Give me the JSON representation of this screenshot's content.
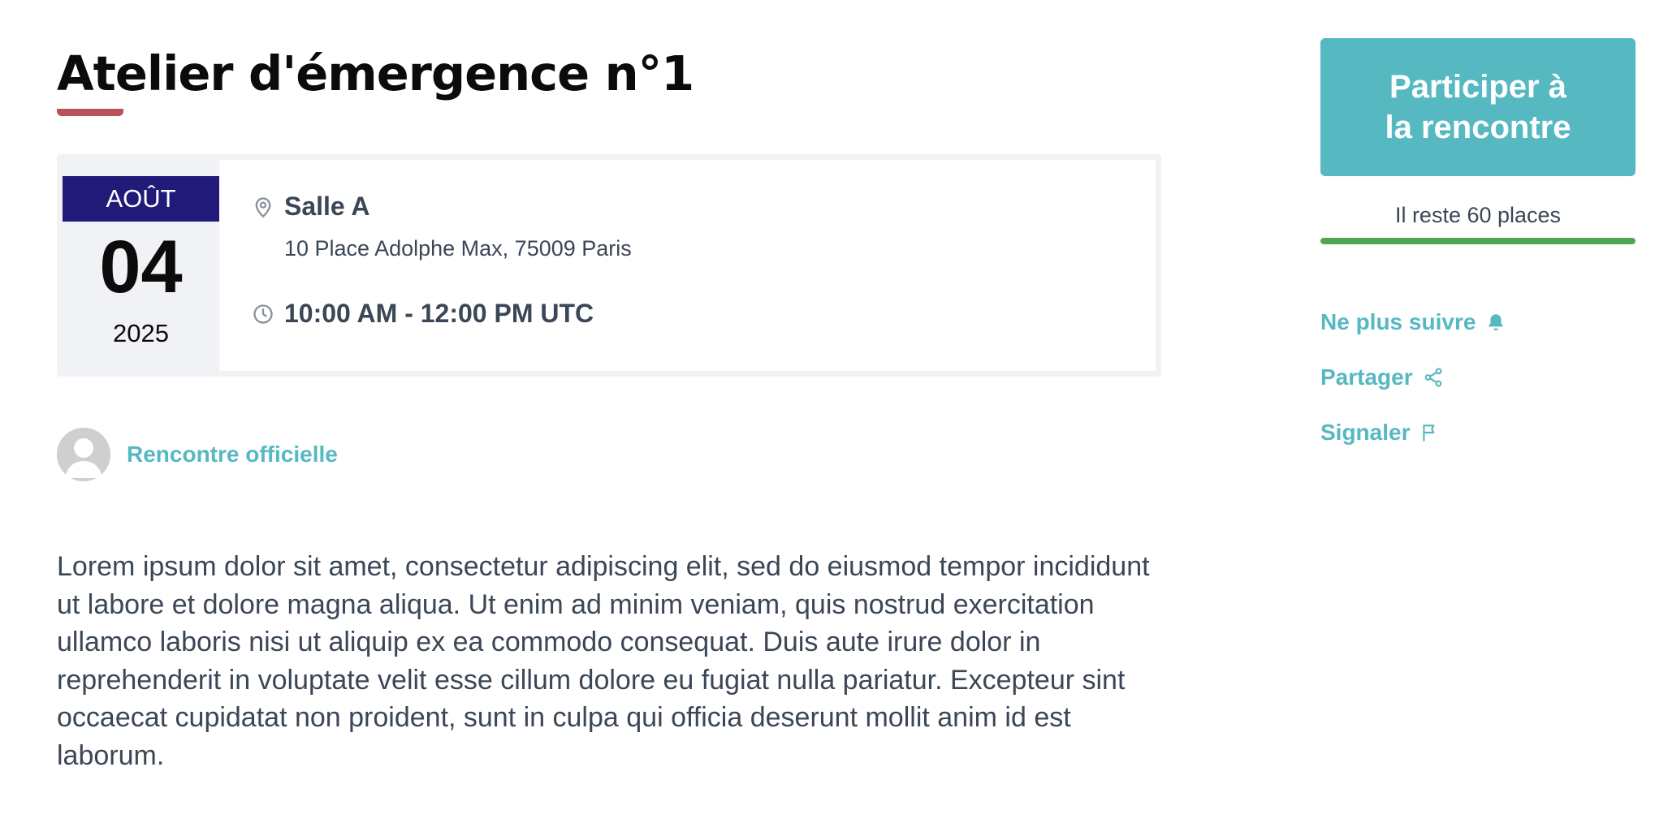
{
  "event": {
    "title": "Atelier d'émergence n°1",
    "date": {
      "month": "AOÛT",
      "day": "04",
      "year": "2025"
    },
    "location": {
      "name": "Salle A",
      "address": "10 Place Adolphe Max, 75009 Paris"
    },
    "time": "10:00 AM - 12:00 PM UTC",
    "organizer": "Rencontre officielle",
    "description": "Lorem ipsum dolor sit amet, consectetur adipiscing elit, sed do eiusmod tempor incididunt ut labore et dolore magna aliqua. Ut enim ad minim veniam, quis nostrud exercitation ullamco laboris nisi ut aliquip ex ea commodo consequat. Duis aute irure dolor in reprehenderit in voluptate velit esse cillum dolore eu fugiat nulla pariatur. Excepteur sint occaecat cupidatat non proident, sunt in culpa qui officia deserunt mollit anim id est laborum."
  },
  "sidebar": {
    "join_line1": "Participer à",
    "join_line2": "la rencontre",
    "places_text": "Il reste 60 places",
    "places_progress_fraction": 1.0,
    "actions": [
      {
        "label": "Ne plus suivre",
        "icon": "bell-icon"
      },
      {
        "label": "Partager",
        "icon": "share-icon"
      },
      {
        "label": "Signaler",
        "icon": "flag-icon"
      }
    ]
  },
  "colors": {
    "accent": "#56b9c1",
    "month_band": "#221a78",
    "title_underline": "#b9525a",
    "progress": "#4fa551",
    "text": "#3b4656"
  }
}
